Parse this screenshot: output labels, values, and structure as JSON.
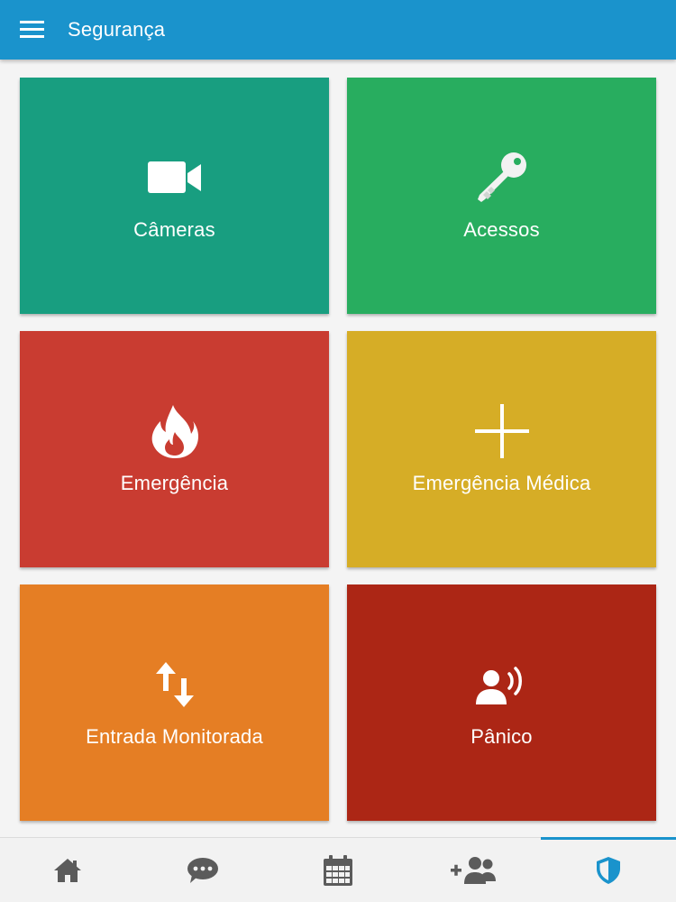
{
  "appbar": {
    "title": "Segurança",
    "menu_icon": "hamburger-menu-icon",
    "color": "#1a93cc"
  },
  "tiles": [
    {
      "label": "Câmeras",
      "icon": "video-camera-icon",
      "color": "#189e80"
    },
    {
      "label": "Acessos",
      "icon": "key-icon",
      "color": "#28ad5f"
    },
    {
      "label": "Emergência",
      "icon": "fire-icon",
      "color": "#c93c31"
    },
    {
      "label": "Emergência Médica",
      "icon": "plus-icon",
      "color": "#d6ad26"
    },
    {
      "label": "Entrada Monitorada",
      "icon": "up-down-arrows-icon",
      "color": "#e57e24"
    },
    {
      "label": "Pânico",
      "icon": "person-alert-icon",
      "color": "#ac2615"
    }
  ],
  "bottom_nav": {
    "items": [
      {
        "icon": "home-icon",
        "active": false
      },
      {
        "icon": "chat-icon",
        "active": false
      },
      {
        "icon": "calendar-icon",
        "active": false
      },
      {
        "icon": "add-group-icon",
        "active": false
      },
      {
        "icon": "shield-icon",
        "active": true
      }
    ],
    "active_color": "#1a93cc",
    "inactive_color": "#5b5b5b"
  }
}
